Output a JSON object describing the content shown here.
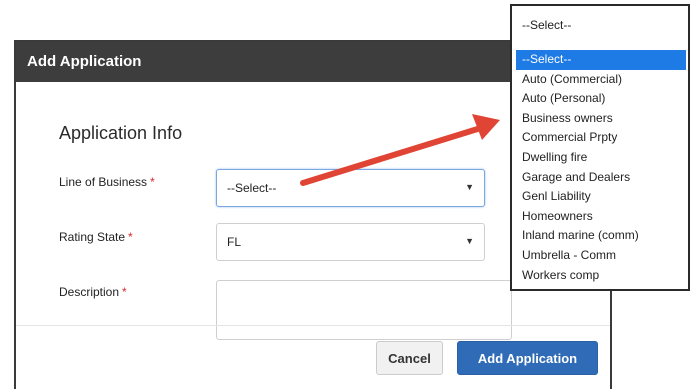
{
  "modal": {
    "title": "Add Application",
    "section_title": "Application Info",
    "required_mark": "*",
    "fields": {
      "line_of_business": {
        "label": "Line of Business",
        "value": "--Select--"
      },
      "rating_state": {
        "label": "Rating State",
        "value": "FL"
      },
      "description": {
        "label": "Description",
        "value": ""
      }
    },
    "buttons": {
      "cancel": "Cancel",
      "add": "Add Application"
    }
  },
  "dropdown": {
    "current": "--Select--",
    "options": [
      "--Select--",
      "Auto (Commercial)",
      "Auto (Personal)",
      "Business owners",
      "Commercial Prpty",
      "Dwelling fire",
      "Garage and Dealers",
      "Genl Liability",
      "Homeowners",
      "Inland marine (comm)",
      "Umbrella - Comm",
      "Workers comp"
    ],
    "highlighted_index": 0
  },
  "colors": {
    "header_bg": "#3d3d3d",
    "primary_button": "#2f6bb7",
    "highlight": "#1e7be6",
    "annotation_arrow": "#e04434",
    "required": "#d9262a"
  },
  "icons": {
    "select_caret": "caret-down-icon",
    "annotation": "red-arrow"
  }
}
